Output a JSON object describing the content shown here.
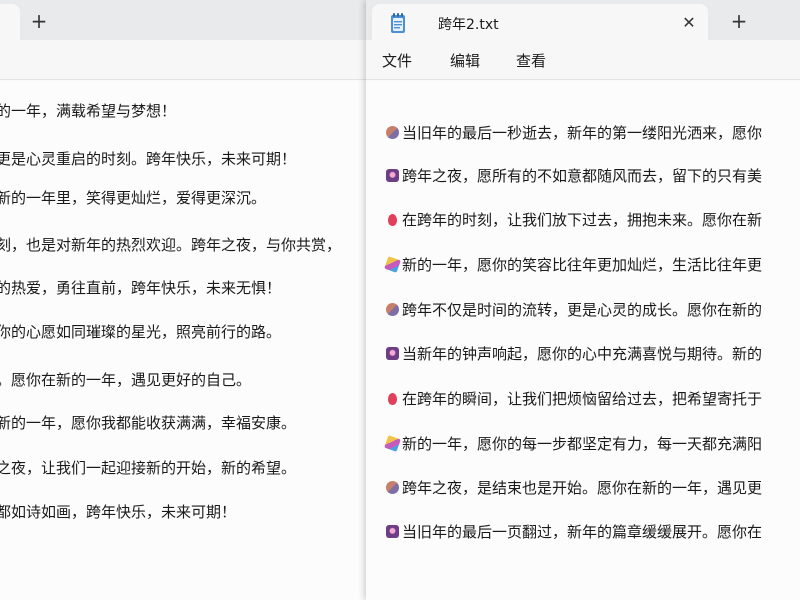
{
  "left_window": {
    "new_tab": "+",
    "lines": [
      "的一年，满载希望与梦想！",
      "更是心灵重启的时刻。跨年快乐，未来可期！",
      "新的一年里，笑得更灿烂，爱得更深沉。",
      "刻，也是对新年的热烈欢迎。跨年之夜，与你共赏，",
      "的热爱，勇往直前，跨年快乐，未来无惧！",
      "你的心愿如同璀璨的星光，照亮前行的路。",
      "。愿你在新的一年，遇见更好的自己。",
      "新的一年，愿你我都能收获满满，幸福安康。",
      "之夜，让我们一起迎接新的开始，新的希望。",
      "都如诗如画，跨年快乐，未来可期！"
    ]
  },
  "right_window": {
    "tab_title": "跨年2.txt",
    "close": "✕",
    "new_tab": "+",
    "menu": {
      "file": "文件",
      "edit": "编辑",
      "view": "查看"
    },
    "lines": [
      {
        "icon": "people-icon",
        "text": "当旧年的最后一秒逝去，新年的第一缕阳光洒来，愿你"
      },
      {
        "icon": "fireworks-icon",
        "text": "跨年之夜，愿所有的不如意都随风而去，留下的只有美"
      },
      {
        "icon": "balloon-icon",
        "text": "在跨年的时刻，让我们放下过去，拥抱未来。愿你在新"
      },
      {
        "icon": "party-popper-icon",
        "text": "新的一年，愿你的笑容比往年更加灿烂，生活比往年更"
      },
      {
        "icon": "people-icon",
        "text": "跨年不仅是时间的流转，更是心灵的成长。愿你在新的"
      },
      {
        "icon": "fireworks-icon",
        "text": "当新年的钟声响起，愿你的心中充满喜悦与期待。新的"
      },
      {
        "icon": "balloon-icon",
        "text": "在跨年的瞬间，让我们把烦恼留给过去，把希望寄托于"
      },
      {
        "icon": "party-popper-icon",
        "text": "新的一年，愿你的每一步都坚定有力，每一天都充满阳"
      },
      {
        "icon": "people-icon",
        "text": "跨年之夜，是结束也是开始。愿你在新的一年，遇见更"
      },
      {
        "icon": "fireworks-icon",
        "text": "当旧年的最后一页翻过，新年的篇章缓缓展开。愿你在"
      }
    ]
  }
}
